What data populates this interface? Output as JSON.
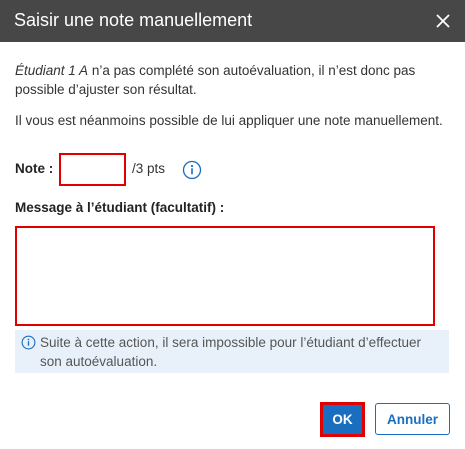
{
  "dialog": {
    "title": "Saisir une note manuellement",
    "close_icon": "close-icon"
  },
  "body": {
    "student_name": "Étudiant 1 A",
    "desc1_rest": " n’a pas complété son autoévaluation, il n’est donc pas possible d’ajuster son résultat.",
    "desc2": "Il vous est néanmoins possible de lui appliquer une note manuellement.",
    "note_label": "Note :",
    "note_value": "",
    "note_suffix": "/3 pts",
    "info_icon": "info-circle-icon",
    "message_label": "Message à l’étudiant (facultatif) :",
    "message_value": "",
    "notice_icon": "info-circle-icon",
    "notice_text": "Suite à cette action, il sera impossible pour l’étudiant d’effectuer son autoévaluation."
  },
  "footer": {
    "ok_label": "OK",
    "cancel_label": "Annuler"
  },
  "colors": {
    "titlebar": "#474747",
    "primary": "#1a6ec0",
    "highlight": "#e00000",
    "notice_bg": "#e8f1fa"
  }
}
